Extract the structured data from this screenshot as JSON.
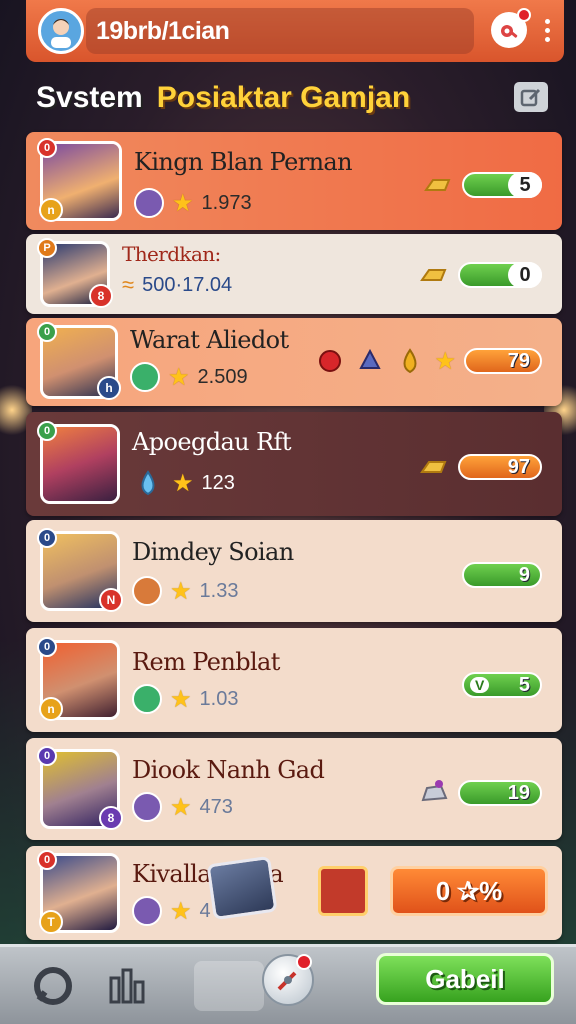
{
  "topbar": {
    "title": "19brb/1cian",
    "accent": "#e8623a"
  },
  "header": {
    "title_white": "Svstem",
    "title_gold": "Posiaktar Gamjan"
  },
  "rows": [
    {
      "name": "Kingn Blan Pernan",
      "score": "1.973",
      "bar_value": "5",
      "rank": "0"
    },
    {
      "name": "Therdkan:",
      "score": "500·17.04",
      "bar_value": "0",
      "rank": "P"
    },
    {
      "name": "Warat Aliedot",
      "score": "2.509",
      "bar_value": "79",
      "rank": "0"
    },
    {
      "name": "Apoegdau Rft",
      "score": "123",
      "bar_value": "97",
      "rank": "0"
    },
    {
      "name": "Dimdey Soian",
      "score": "1.33",
      "bar_value": "9",
      "rank": "0"
    },
    {
      "name": "Rem Penblat",
      "score": "1.03",
      "bar_value": "5",
      "bar_left": "V",
      "rank": "0"
    },
    {
      "name": "Diook Nanh Gad",
      "score": "473",
      "bar_value": "19",
      "rank": "0"
    },
    {
      "name": "Kivalla lnn0a",
      "score": "4",
      "rank": "0"
    }
  ],
  "actions": {
    "orange_button": "0 ✰%",
    "cta_button": "Gabeil"
  },
  "icons": [
    "user-avatar-icon",
    "search-bar",
    "gear-icon",
    "more-icon",
    "edit-icon",
    "star-icon",
    "chat-icon",
    "stats-icon",
    "compass-icon"
  ]
}
